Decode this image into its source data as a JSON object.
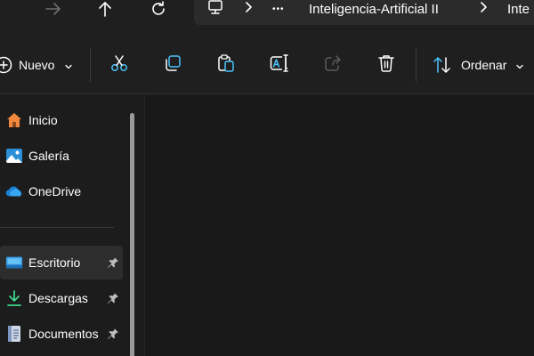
{
  "address_bar": {
    "forward_icon": "arrow-right-icon",
    "up_icon": "arrow-up-icon",
    "refresh_icon": "refresh-icon",
    "breadcrumb": [
      "Inteligencia-Artificial II",
      "Inte"
    ],
    "more_label": "•••"
  },
  "command_bar": {
    "new_label": "Nuevo",
    "sort_label": "Ordenar",
    "icons": [
      "cut-icon",
      "copy-icon",
      "paste-icon",
      "rename-icon",
      "share-icon",
      "delete-icon"
    ]
  },
  "nav_pane": {
    "items": [
      {
        "label": "Inicio",
        "icon": "home-icon"
      },
      {
        "label": "Galería",
        "icon": "gallery-icon"
      },
      {
        "label": "OneDrive",
        "icon": "cloud-icon"
      },
      {
        "label": "Escritorio",
        "icon": "desktop-folder-icon",
        "pinned": true
      },
      {
        "label": "Descargas",
        "icon": "download-icon",
        "pinned": true
      },
      {
        "label": "Documentos",
        "icon": "document-icon",
        "pinned": true
      }
    ]
  },
  "colors": {
    "accent": "#4cc2ff",
    "background": "#1c1c1c",
    "home_orange": "#f0883e"
  }
}
